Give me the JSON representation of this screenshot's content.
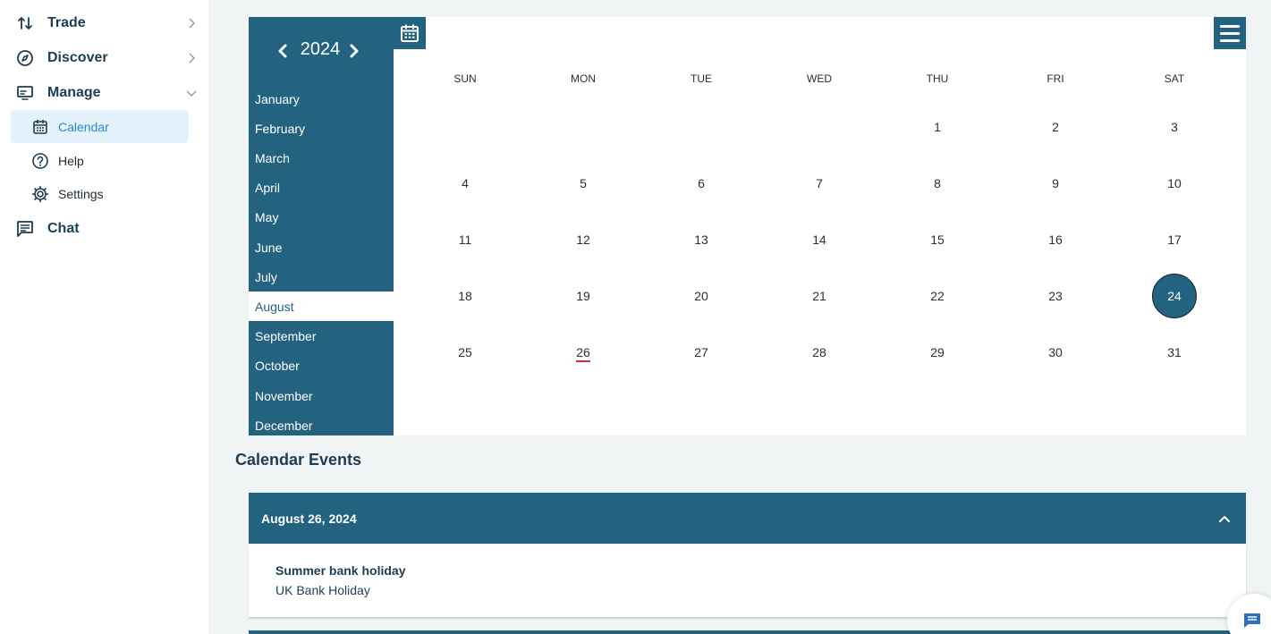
{
  "sidebar": {
    "trade": "Trade",
    "discover": "Discover",
    "manage": "Manage",
    "calendar": "Calendar",
    "help": "Help",
    "settings": "Settings",
    "chat": "Chat"
  },
  "calendar": {
    "year": "2024",
    "months": [
      "January",
      "February",
      "March",
      "April",
      "May",
      "June",
      "July",
      "August",
      "September",
      "October",
      "November",
      "December"
    ],
    "selected_month": "August",
    "weekdays": [
      "SUN",
      "MON",
      "TUE",
      "WED",
      "THU",
      "FRI",
      "SAT"
    ],
    "days": [
      [
        "",
        "",
        "",
        "",
        "1",
        "2",
        "3"
      ],
      [
        "4",
        "5",
        "6",
        "7",
        "8",
        "9",
        "10"
      ],
      [
        "11",
        "12",
        "13",
        "14",
        "15",
        "16",
        "17"
      ],
      [
        "18",
        "19",
        "20",
        "21",
        "22",
        "23",
        "24"
      ],
      [
        "25",
        "26",
        "27",
        "28",
        "29",
        "30",
        "31"
      ]
    ],
    "selected_day": "24",
    "event_day": "26"
  },
  "events": {
    "title": "Calendar Events",
    "items": [
      {
        "date": "August 26, 2024",
        "name": "Summer bank holiday",
        "type": "UK Bank Holiday"
      }
    ]
  },
  "colors": {
    "primary": "#236380",
    "accent": "#2a8bc4",
    "event_marker": "#d93025"
  },
  "icons": {
    "trade": "swap-vertical-icon",
    "discover": "compass-icon",
    "manage": "monitor-icon",
    "calendar": "calendar-icon",
    "help": "help-circle-icon",
    "settings": "gear-icon",
    "chat": "chat-icon",
    "menu": "hamburger-icon"
  }
}
